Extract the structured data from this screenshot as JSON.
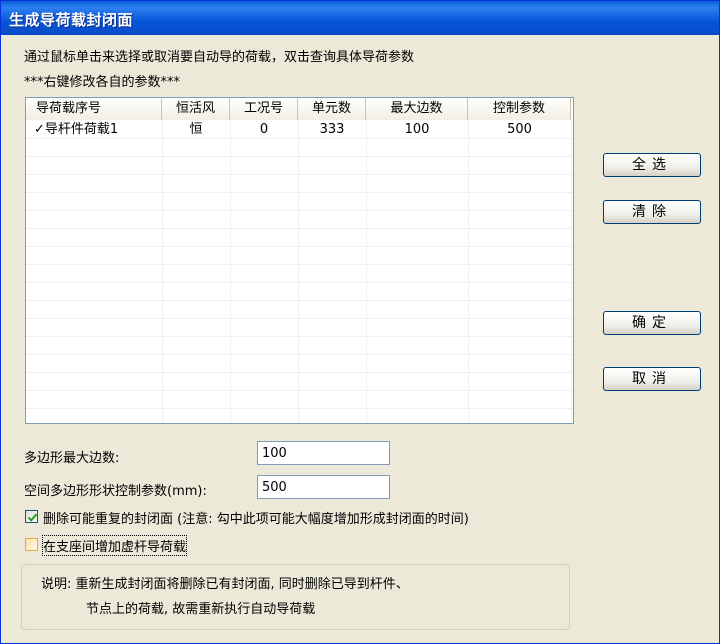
{
  "window": {
    "title": "生成导荷载封闭面"
  },
  "instructions": {
    "line1": "通过鼠标单击来选择或取消要自动导的荷载，双击查询具体导荷参数",
    "line2": "***右键修改各自的参数***"
  },
  "table": {
    "columns": [
      "导荷载序号",
      "恒活风",
      "工况号",
      "单元数",
      "最大边数",
      "控制参数"
    ],
    "rows": [
      {
        "check": "✓",
        "name": "导杆件荷载1",
        "type": "恒",
        "case": "0",
        "elements": "333",
        "max_edges": "100",
        "control": "500"
      }
    ]
  },
  "buttons": {
    "select_all": "全选",
    "clear": "清除",
    "ok": "确定",
    "cancel": "取消"
  },
  "fields": {
    "max_edges_label": "多边形最大边数:",
    "max_edges_value": "100",
    "shape_param_label": "空间多边形形状控制参数(mm):",
    "shape_param_value": "500"
  },
  "options": {
    "delete_dup_label": "删除可能重复的封闭面 (注意: 勾中此项可能大幅度增加形成封闭面的时间)",
    "delete_dup_checked": true,
    "add_virtual_label": "在支座间增加虚杆导荷载",
    "add_virtual_checked": false
  },
  "note": {
    "line1": "说明: 重新生成封闭面将删除已有封闭面, 同时删除已导到杆件、",
    "line2": "节点上的荷载, 故需重新执行自动导荷载"
  },
  "colors": {
    "titlebar": "#0655d9",
    "face": "#ece9d8"
  }
}
